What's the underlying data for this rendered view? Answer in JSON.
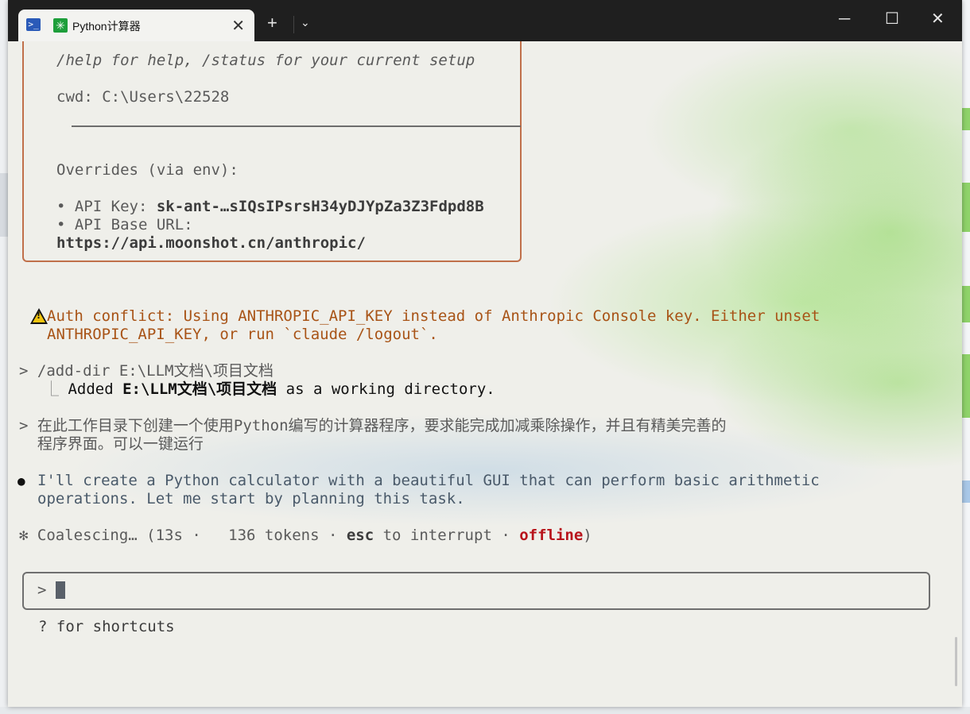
{
  "tabs": {
    "title": "Python计算器",
    "ps_icon": "powershell-icon",
    "app_icon": "claude-icon",
    "new_tab_symbol": "+",
    "dropdown_symbol": "⌄",
    "close_symbol": "✕"
  },
  "window_controls": {
    "minimize": "─",
    "maximize": "☐",
    "close": "✕"
  },
  "info": {
    "help_line": "/help for help, /status for your current setup",
    "cwd_line": "cwd: C:\\Users\\22528",
    "overrides_title": "Overrides (via env):",
    "api_key_label": "• API Key: ",
    "api_key_value": "sk-ant-…sIQsIPsrsH34yDJYpZa3Z3Fdpd8B",
    "base_url_label": "• API Base URL:",
    "base_url_value": "https://api.moonshot.cn/anthropic/"
  },
  "warning": {
    "line1": "Auth conflict: Using ANTHROPIC_API_KEY instead of Anthropic Console key. Either unset",
    "line2": "ANTHROPIC_API_KEY, or run `claude /logout`."
  },
  "adddir": {
    "command": "> /add-dir E:\\LLM文档\\项目文档",
    "branch": "⎿",
    "added_prefix": "Added ",
    "added_path": "E:\\LLM文档\\项目文档",
    "added_suffix": " as a working directory."
  },
  "request": {
    "line1": "> 在此工作目录下创建一个使用Python编写的计算器程序，要求能完成加减乘除操作，并且有精美完善的",
    "line2": "  程序界面。可以一键运行"
  },
  "response": {
    "bullet": "●",
    "line1": "I'll create a Python calculator with a beautiful GUI that can perform basic arithmetic",
    "line2": "operations. Let me start by planning this task."
  },
  "status": {
    "spinner": "✻",
    "text": "Coalescing… (13s ·   136 tokens · ",
    "esc": "esc",
    "to_interrupt": " to interrupt · ",
    "offline": "offline",
    "close": ")"
  },
  "input": {
    "prompt": ">",
    "value": ""
  },
  "hint": "? for shortcuts"
}
